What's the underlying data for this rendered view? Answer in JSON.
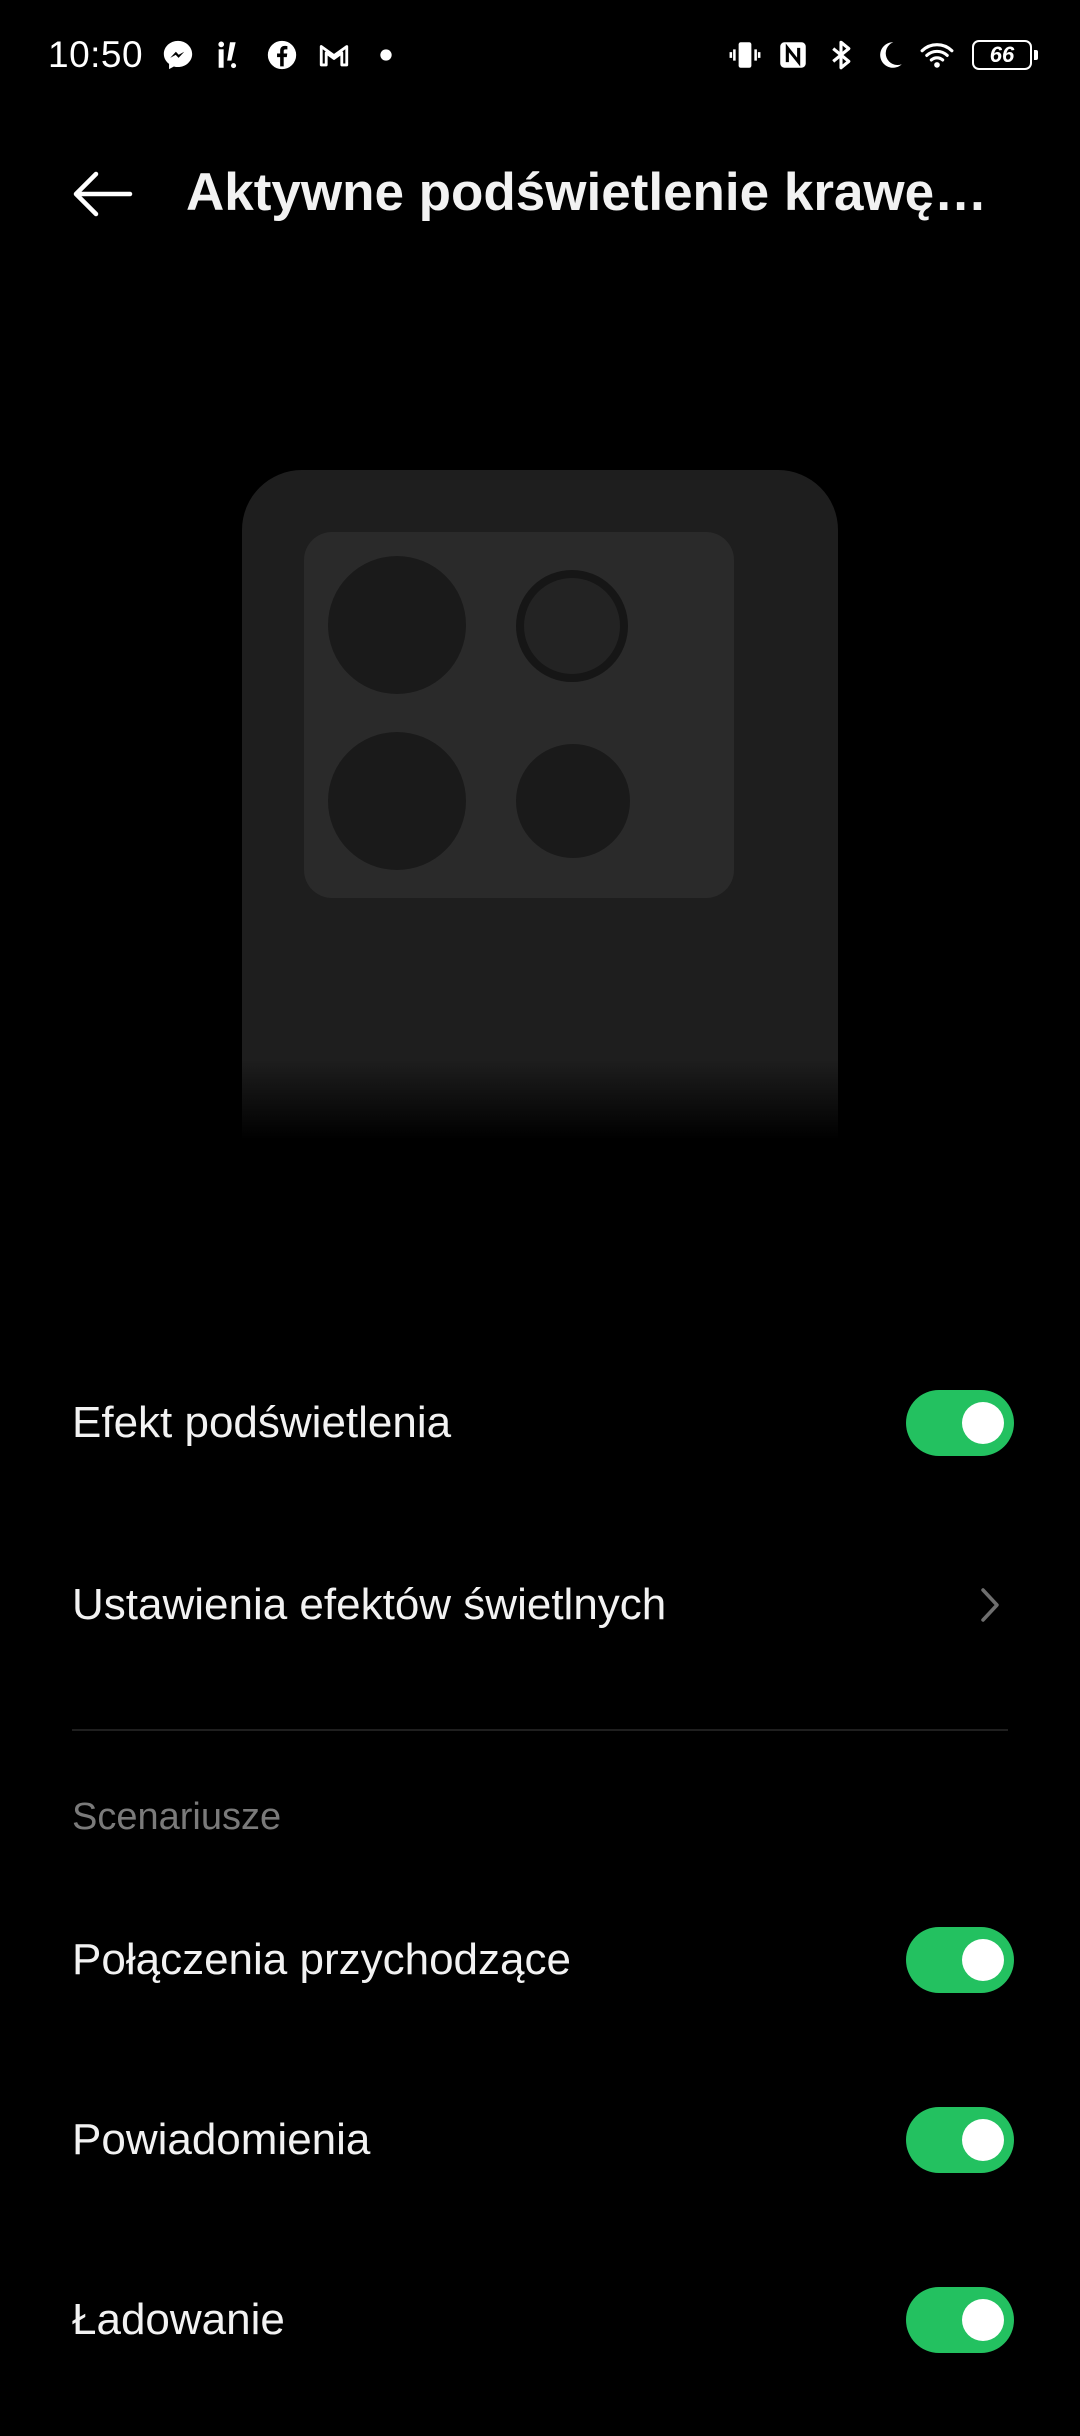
{
  "status_bar": {
    "time": "10:50",
    "battery": "66",
    "left_icons": [
      "messenger-icon",
      "app-notification-icon",
      "facebook-icon",
      "gmail-icon",
      "more-dot-icon"
    ],
    "right_icons": [
      "vibrate-icon",
      "nfc-icon",
      "bluetooth-icon",
      "do-not-disturb-icon",
      "wifi-icon",
      "battery-icon"
    ]
  },
  "header": {
    "title": "Aktywne podświetlenie krawędz..."
  },
  "settings": {
    "items": [
      {
        "label": "Efekt podświetlenia",
        "control": "toggle",
        "on": true
      },
      {
        "label": "Ustawienia efektów świetlnych",
        "control": "chevron"
      }
    ]
  },
  "scenarios": {
    "section_label": "Scenariusze",
    "items": [
      {
        "label": "Połączenia przychodzące",
        "control": "toggle",
        "on": true
      },
      {
        "label": "Powiadomienia",
        "control": "toggle",
        "on": true
      },
      {
        "label": "Ładowanie",
        "control": "toggle",
        "on": true
      }
    ]
  },
  "colors": {
    "background": "#000000",
    "toggle_on": "#23c160",
    "text_primary": "#f2f2f2",
    "text_secondary": "#7a7a7a"
  }
}
